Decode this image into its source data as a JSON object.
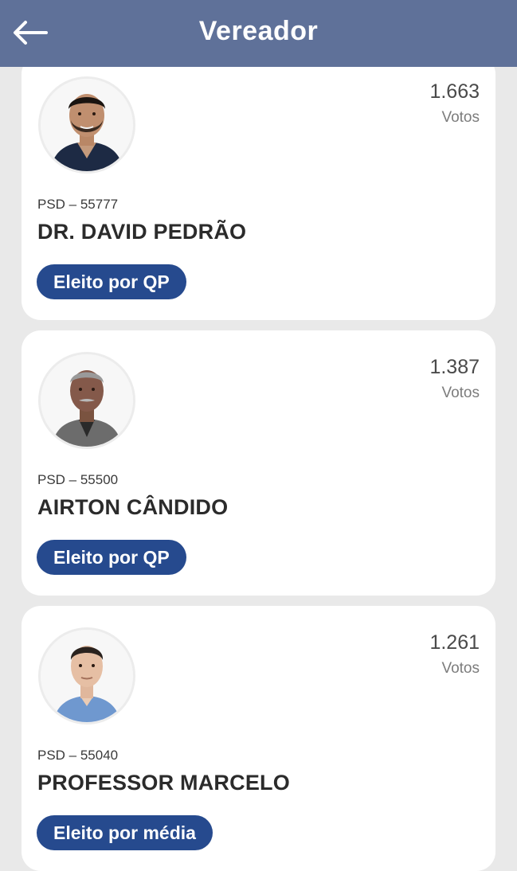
{
  "header": {
    "title": "Vereador",
    "back_icon": "arrow-left-icon"
  },
  "colors": {
    "header_bg": "#5f7199",
    "badge_bg": "#264a8e",
    "page_bg": "#e9e9e9"
  },
  "candidates": [
    {
      "votes": "1.663",
      "votes_label": "Votos",
      "party": "PSD – 55777",
      "name": "DR. DAVID PEDRÃO",
      "status": "Eleito por QP"
    },
    {
      "votes": "1.387",
      "votes_label": "Votos",
      "party": "PSD – 55500",
      "name": "AIRTON CÂNDIDO",
      "status": "Eleito por QP"
    },
    {
      "votes": "1.261",
      "votes_label": "Votos",
      "party": "PSD – 55040",
      "name": "PROFESSOR MARCELO",
      "status": "Eleito por média"
    }
  ]
}
